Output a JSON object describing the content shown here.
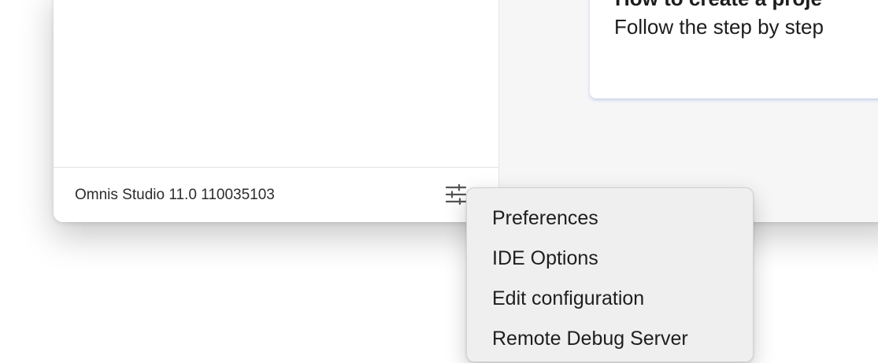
{
  "footer": {
    "version_text": "Omnis Studio 11.0 110035103",
    "settings_icon": "sliders-icon"
  },
  "card": {
    "title": "How to create a proje",
    "description": "Follow the step by step"
  },
  "context_menu": {
    "items": [
      {
        "label": "Preferences"
      },
      {
        "label": "IDE Options"
      },
      {
        "label": "Edit configuration"
      },
      {
        "label": "Remote Debug Server"
      }
    ]
  },
  "colors": {
    "window_bg": "#ffffff",
    "right_pane_bg": "#f6f6f7",
    "menu_bg": "#efefef",
    "card_shadow": "#466ec8"
  }
}
